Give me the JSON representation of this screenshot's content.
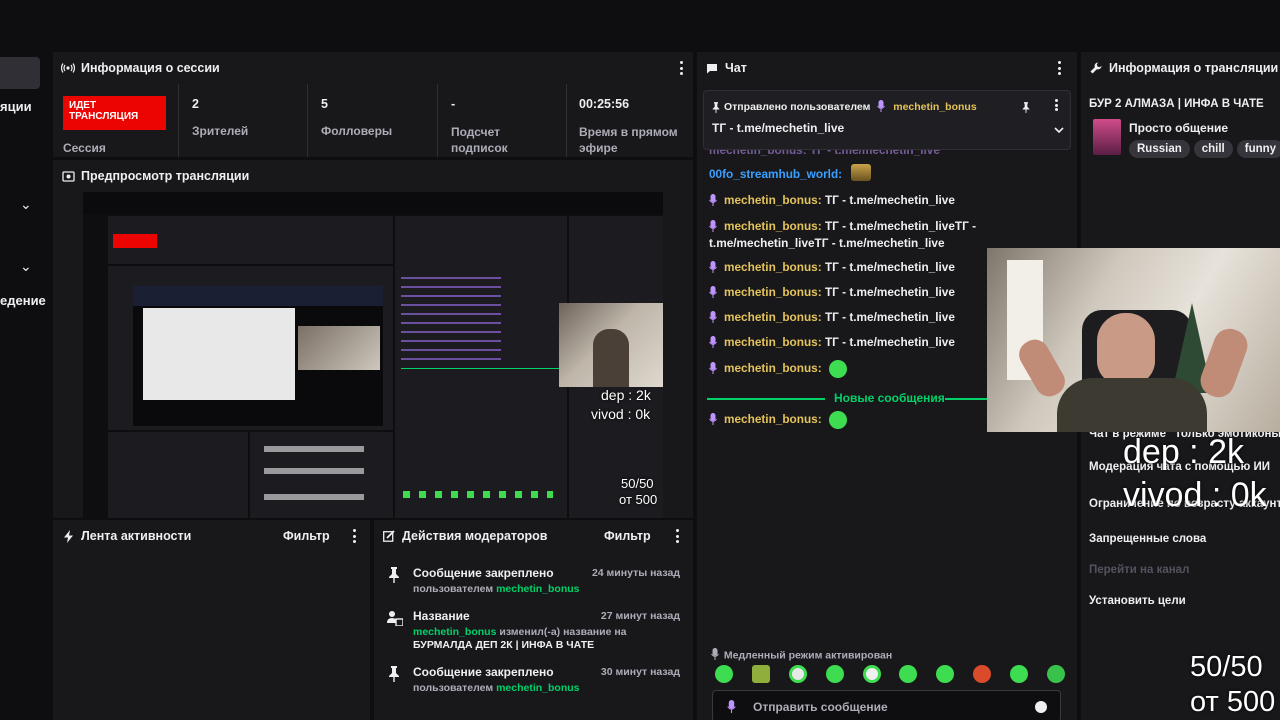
{
  "sidebar": {
    "label_top": "яции",
    "label_bottom": "едение"
  },
  "session": {
    "title": "Информация о сессии",
    "live_badge": "ИДЕТ ТРАНСЛЯЦИЯ",
    "session_label": "Сессия",
    "stats": [
      {
        "value": "2",
        "label": "Зрителей"
      },
      {
        "value": "5",
        "label": "Фолловеры"
      },
      {
        "value": "-",
        "label": "Подсчет подписок"
      },
      {
        "value": "00:25:56",
        "label": "Время в прямом эфире"
      }
    ]
  },
  "preview": {
    "title": "Предпросмотр трансляции",
    "nested_overlay": {
      "dep": "dep : 2k",
      "vivod": "vivod : 0k",
      "count": "50/50",
      "of": "от 500"
    }
  },
  "activity": {
    "title": "Лента активности",
    "filter": "Фильтр"
  },
  "mod_actions": {
    "title": "Действия модераторов",
    "filter": "Фильтр",
    "items": [
      {
        "title": "Сообщение закреплено",
        "time": "24 минуты назад",
        "sub_prefix": "пользователем",
        "user": "mechetin_bonus"
      },
      {
        "title": "Название",
        "time": "27 минут назад",
        "user": "mechetin_bonus",
        "changed": "изменил(-а) название на",
        "new_title": "БУРМАЛДА ДЕП 2К | ИНФА В ЧАТЕ"
      },
      {
        "title": "Сообщение закреплено",
        "time": "30 минут назад",
        "sub_prefix": "пользователем",
        "user": "mechetin_bonus"
      }
    ]
  },
  "chat": {
    "title": "Чат",
    "pinned_by": "Отправлено пользователем",
    "pinned_user": "mechetin_bonus",
    "pinned_text": "ТГ - t.me/mechetin_live",
    "partial_line": "mechetin_bonus: ТГ - t.me/mechetin_live",
    "messages": [
      {
        "user": "00fo_streamhub_world:",
        "text": ""
      },
      {
        "user": "mechetin_bonus:",
        "text": "ТГ - t.me/mechetin_live"
      },
      {
        "user": "mechetin_bonus:",
        "text": "ТГ - t.me/mechetin_liveТГ -",
        "text2": "t.me/mechetin_liveТГ - t.me/mechetin_live"
      },
      {
        "user": "mechetin_bonus:",
        "text": "ТГ - t.me/mechetin_live"
      },
      {
        "user": "mechetin_bonus:",
        "text": "ТГ - t.me/mechetin_live"
      },
      {
        "user": "mechetin_bonus:",
        "text": "ТГ - t.me/mechetin_live"
      },
      {
        "user": "mechetin_bonus:",
        "text": "ТГ - t.me/mechetin_live"
      },
      {
        "user": "mechetin_bonus:",
        "text": ""
      }
    ],
    "new_messages": "Новые сообщения",
    "after_new": {
      "user": "mechetin_bonus:",
      "text": ""
    },
    "slow_mode": "Медленный режим активирован",
    "input_placeholder": "Отправить сообщение"
  },
  "stream_info": {
    "title": "Информация о трансляции",
    "stream_title": "БУР 2 АЛМАЗА | ИНФА В ЧАТЕ",
    "category": "Просто общение",
    "tags": [
      "Russian",
      "chill",
      "funny"
    ],
    "settings": [
      "Чат в режиме \"Только эмотиконы\"",
      "Модерация чата с помощью ИИ",
      "Ограничение по возрасту аккаунта",
      "Запрещенные слова",
      "Перейти на канал",
      "Установить цели"
    ]
  },
  "overlay": {
    "dep": "dep : 2k",
    "vivod": "vivod : 0k",
    "count": "50/50",
    "of": "от 500"
  },
  "colors": {
    "live_red": "#eb0400",
    "kick_green": "#00d26a",
    "username_yellow": "#e3c35a",
    "panel_bg": "#18181b",
    "page_bg": "#0e0e10"
  }
}
